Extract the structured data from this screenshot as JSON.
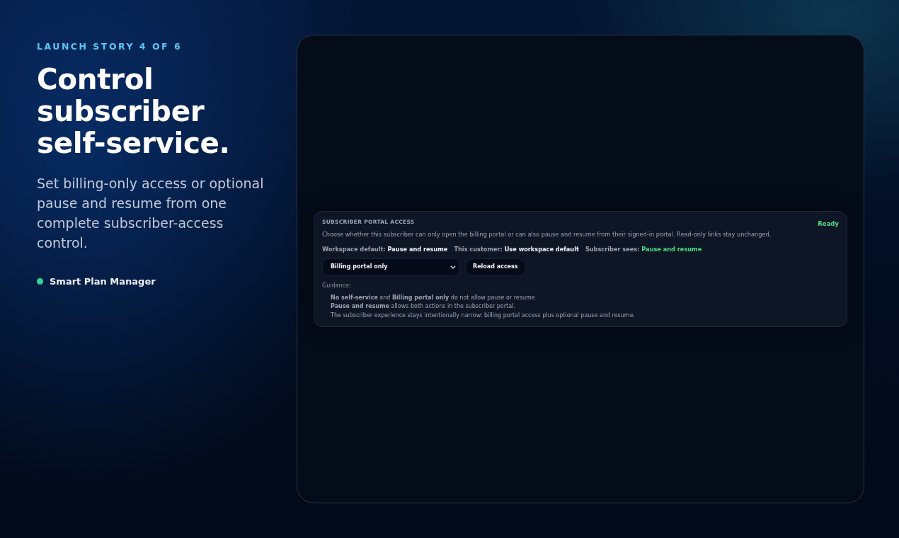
{
  "hero": {
    "eyebrow": "LAUNCH STORY 4 OF 6",
    "headline": "Control subscriber self-service.",
    "summary": "Set billing-only access or optional pause and resume from one complete subscriber-access control.",
    "brand": {
      "label": "Smart Plan Manager",
      "color": "#34d399"
    }
  },
  "panel": {
    "title": "SUBSCRIBER PORTAL ACCESS",
    "status": "Ready",
    "description": "Choose whether this subscriber can only open the billing portal or can also pause and resume from their signed-in portal. Read-only links stay unchanged.",
    "facts": [
      {
        "label": "Workspace default:",
        "value": "Pause and resume",
        "highlight": false
      },
      {
        "label": "This customer:",
        "value": "Use workspace default",
        "highlight": false
      },
      {
        "label": "Subscriber sees:",
        "value": "Pause and resume",
        "highlight": true
      }
    ],
    "access_select": {
      "value": "Billing portal only"
    },
    "reload_button": "Reload access",
    "guidance_label": "Guidance:",
    "guidance": [
      "**No self-service** and **Billing portal only** do not allow pause or resume.",
      "**Pause and resume** allows both actions in the subscriber portal.",
      "The subscriber experience stays intentionally narrow: billing portal access plus optional pause and resume."
    ]
  }
}
